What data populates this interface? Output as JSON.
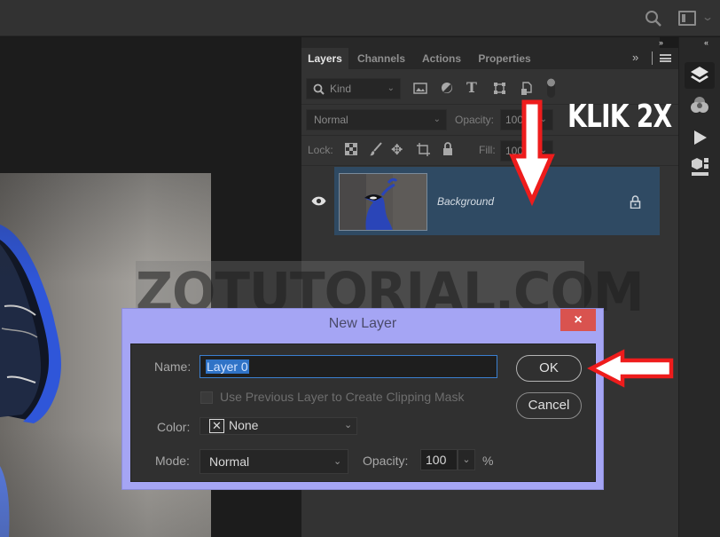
{
  "topbar": {
    "search_icon": "search-icon",
    "workspace_icon": "workspace-icon",
    "workspace_chevron": "⌄"
  },
  "panel": {
    "collapse_label": "››",
    "tabs": [
      {
        "label": "Layers",
        "active": true
      },
      {
        "label": "Channels",
        "active": false
      },
      {
        "label": "Actions",
        "active": false
      },
      {
        "label": "Properties",
        "active": false
      }
    ],
    "more_label": "»",
    "filter": {
      "kind_label": "Kind",
      "icons": [
        "image-filter-icon",
        "adjustment-filter-icon",
        "type-filter-icon",
        "shape-filter-icon",
        "smart-object-filter-icon",
        "filter-toggle-icon"
      ]
    },
    "blend_mode": "Normal",
    "opacity_label": "Opacity:",
    "opacity_value": "100",
    "lock_label": "Lock:",
    "lock_icons": [
      "lock-transparency-icon",
      "lock-paint-icon",
      "lock-position-icon",
      "lock-artboard-icon",
      "lock-all-icon"
    ],
    "fill_label": "Fill:",
    "fill_value": "100",
    "layers": [
      {
        "name": "Background",
        "visible": true,
        "locked": true,
        "selected": true
      }
    ]
  },
  "right_toolbar": {
    "collapse_label": "‹‹",
    "buttons": [
      "layers-panel-icon",
      "channels-panel-icon",
      "actions-panel-icon",
      "3d-panel-icon"
    ]
  },
  "watermark": "ZOTUTORIAL.COM",
  "annotation": {
    "klik_text": "KLIK 2X",
    "arrow_color": "#ff0000"
  },
  "dialog": {
    "title": "New Layer",
    "close_label": "×",
    "name_label": "Name:",
    "name_value": "Layer 0",
    "clip_label": "Use Previous Layer to Create Clipping Mask",
    "clip_checked": false,
    "color_label": "Color:",
    "color_value": "None",
    "mode_label": "Mode:",
    "mode_value": "Normal",
    "opacity_label": "Opacity:",
    "opacity_value": "100",
    "opacity_unit": "%",
    "ok_label": "OK",
    "cancel_label": "Cancel"
  }
}
